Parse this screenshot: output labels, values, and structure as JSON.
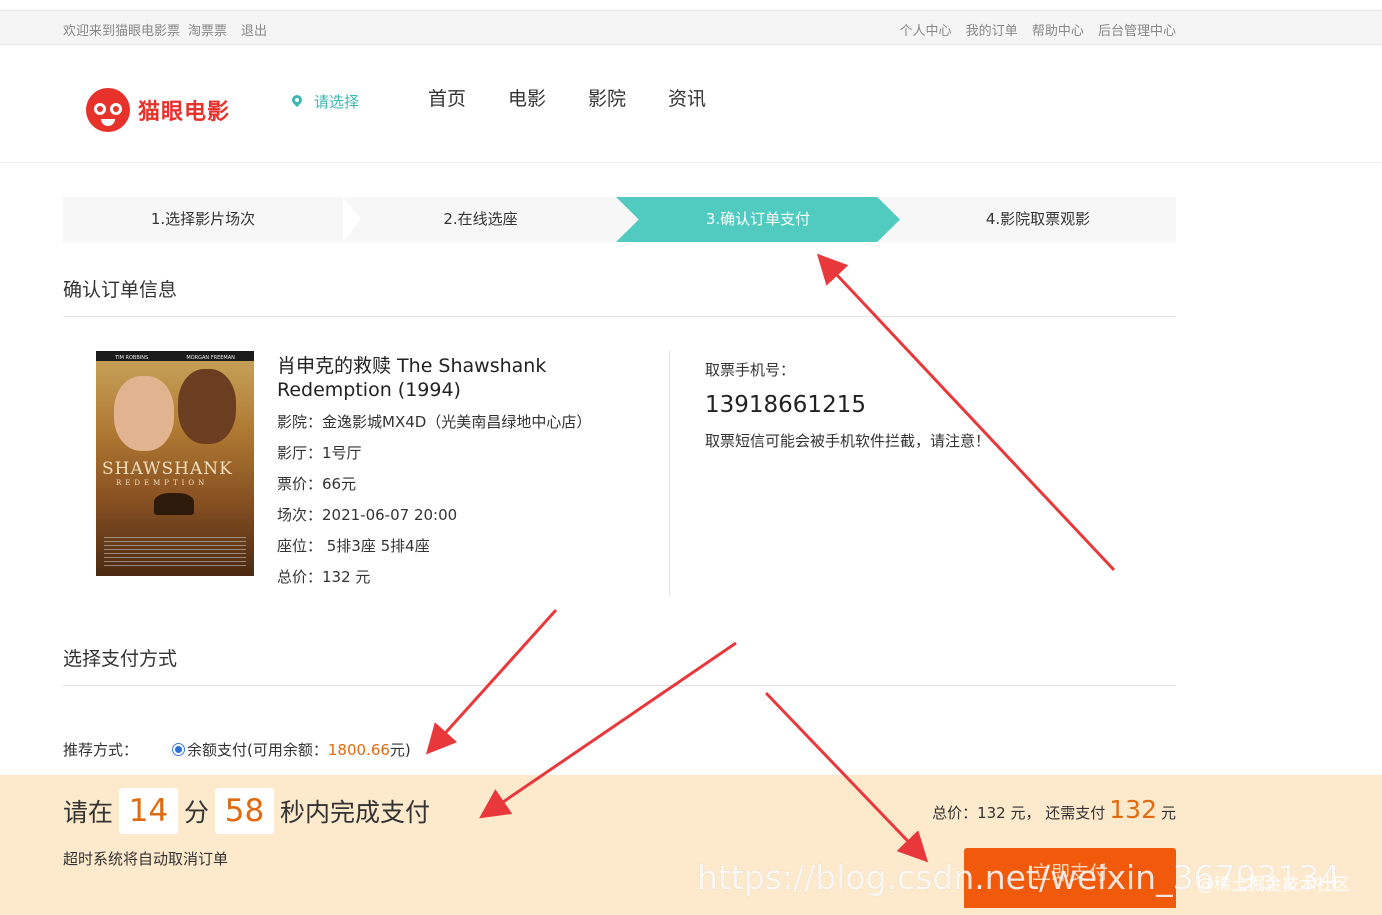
{
  "topbar": {
    "welcome": "欢迎来到猫眼电影票",
    "taopiaopiao": "淘票票",
    "logout": "退出",
    "links": [
      "个人中心",
      "我的订单",
      "帮助中心",
      "后台管理中心"
    ]
  },
  "header": {
    "logo_text": "猫眼电影",
    "city": "请选择",
    "nav": [
      "首页",
      "电影",
      "影院",
      "资讯"
    ]
  },
  "steps": [
    "1.选择影片场次",
    "2.在线选座",
    "3.确认订单支付",
    "4.影院取票观影"
  ],
  "order": {
    "section_title": "确认订单信息",
    "poster": {
      "actors": [
        "TIM ROBBINS",
        "MORGAN FREEMAN"
      ],
      "title": "SHAWSHANK",
      "subtitle": "REDEMPTION"
    },
    "movie_name": "肖申克的救赎 The Shawshank Redemption (1994)",
    "cinema": "影院：金逸影城MX4D（光美南昌绿地中心店）",
    "hall": "影厅：1号厅",
    "price": "票价：66元",
    "showtime": "场次：2021-06-07 20:00",
    "seats": "座位： 5排3座 5排4座",
    "total": "总价：132 元",
    "phone_label": "取票手机号：",
    "phone": "13918661215",
    "phone_tip": "取票短信可能会被手机软件拦截，请注意！"
  },
  "payment": {
    "section_title": "选择支付方式",
    "recommend_label": "推荐方式：",
    "option_prefix": "余额支付(可用余额：",
    "balance": "1800.66",
    "option_suffix": "元)"
  },
  "footer": {
    "prefix": "请在",
    "minutes": "14",
    "minute_unit": "分",
    "seconds": "58",
    "suffix": "秒内完成支付",
    "timeout_note": "超时系统将自动取消订单",
    "total_text": "总价：132 元， 还需支付",
    "amount_due": "132",
    "amount_unit": "元",
    "pay_button": "立即支付"
  },
  "watermark": {
    "url": "https://blog.csdn.net/weixin_36793134",
    "community": "@稀土掘金技术社区"
  },
  "colors": {
    "accent_teal": "#51cbc0",
    "brand_red": "#e6322b",
    "orange": "#f15a0a",
    "footer_bg": "#fde9cc"
  }
}
